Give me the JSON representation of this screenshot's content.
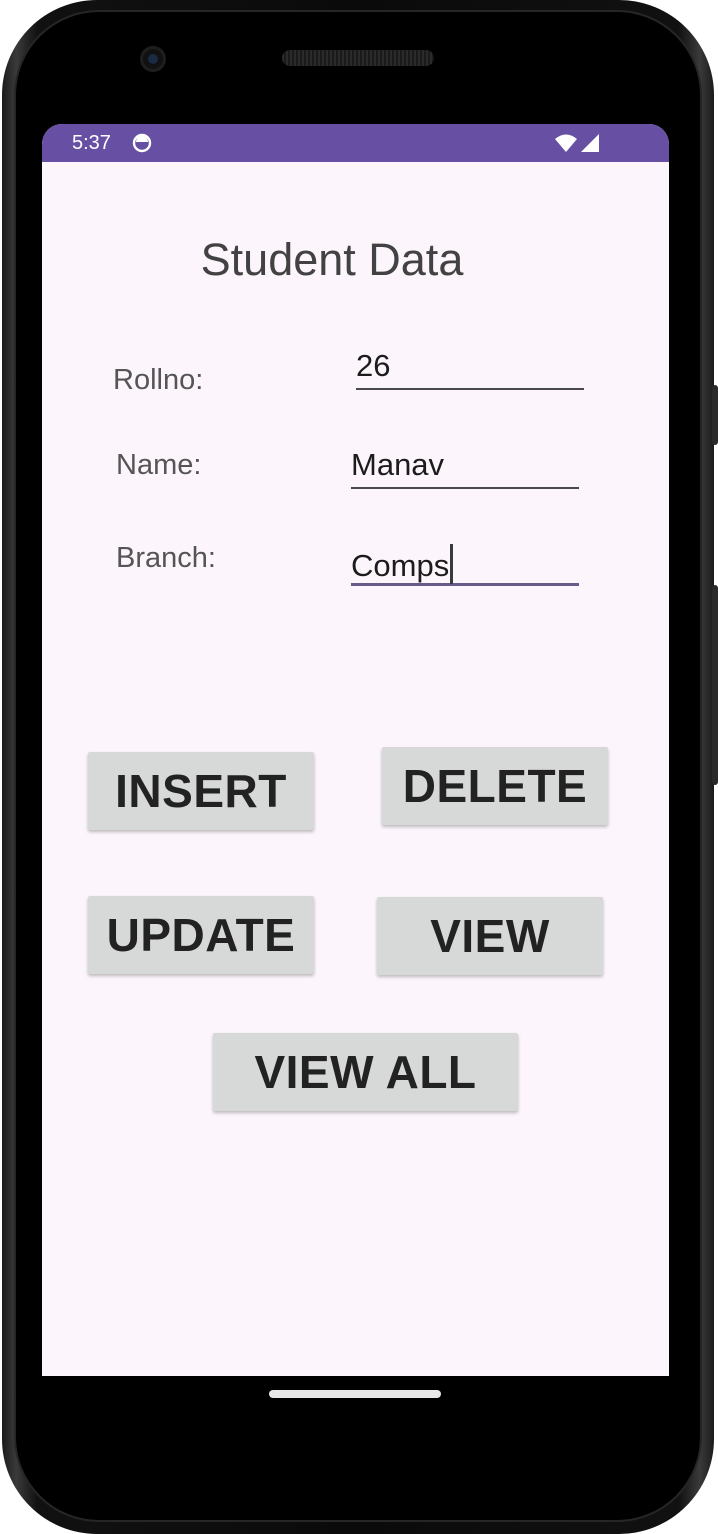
{
  "status_bar": {
    "time": "5:37",
    "app_icon": "android-notification-icon",
    "wifi_icon": "wifi-icon",
    "signal_icon": "cell-signal-icon",
    "color": "#6750a4"
  },
  "page": {
    "title": "Student Data"
  },
  "form": {
    "rollno_label": "Rollno:",
    "rollno_value": "26",
    "name_label": "Name:",
    "name_value": "Manav",
    "branch_label": "Branch:",
    "branch_value": "Comps"
  },
  "buttons": {
    "insert": "INSERT",
    "delete": "DELETE",
    "update": "UPDATE",
    "view": "VIEW",
    "view_all": "VIEW ALL"
  }
}
